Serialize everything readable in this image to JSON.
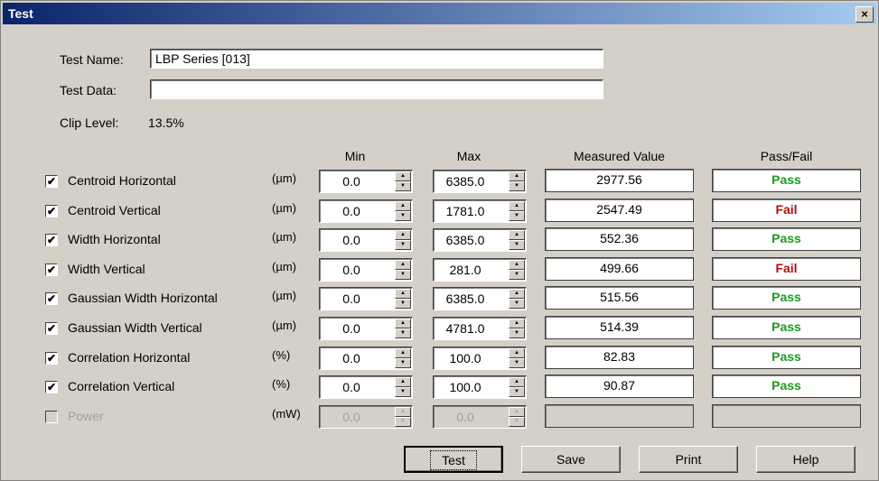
{
  "window": {
    "title": "Test",
    "close_label": "×"
  },
  "form": {
    "test_name_label": "Test Name:",
    "test_name_value": "LBP Series [013]",
    "test_data_label": "Test Data:",
    "test_data_value": "",
    "clip_level_label": "Clip Level:",
    "clip_level_value": "13.5%"
  },
  "columns": {
    "min": "Min",
    "max": "Max",
    "measured": "Measured Value",
    "passfail": "Pass/Fail"
  },
  "rows": [
    {
      "label": "Centroid Horizontal",
      "unit": "(µm)",
      "min": "0.0",
      "max": "6385.0",
      "measured": "2977.56",
      "result": "Pass",
      "checked": "✔"
    },
    {
      "label": "Centroid Vertical",
      "unit": "(µm)",
      "min": "0.0",
      "max": "1781.0",
      "measured": "2547.49",
      "result": "Fail",
      "checked": "✔"
    },
    {
      "label": "Width Horizontal",
      "unit": "(µm)",
      "min": "0.0",
      "max": "6385.0",
      "measured": "552.36",
      "result": "Pass",
      "checked": "✔"
    },
    {
      "label": "Width Vertical",
      "unit": "(µm)",
      "min": "0.0",
      "max": "281.0",
      "measured": "499.66",
      "result": "Fail",
      "checked": "✔"
    },
    {
      "label": "Gaussian Width Horizontal",
      "unit": "(µm)",
      "min": "0.0",
      "max": "6385.0",
      "measured": "515.56",
      "result": "Pass",
      "checked": "✔"
    },
    {
      "label": "Gaussian Width Vertical",
      "unit": "(µm)",
      "min": "0.0",
      "max": "4781.0",
      "measured": "514.39",
      "result": "Pass",
      "checked": "✔"
    },
    {
      "label": "Correlation Horizontal",
      "unit": "(%)",
      "min": "0.0",
      "max": "100.0",
      "measured": "82.83",
      "result": "Pass",
      "checked": "✔"
    },
    {
      "label": "Correlation Vertical",
      "unit": "(%)",
      "min": "0.0",
      "max": "100.0",
      "measured": "90.87",
      "result": "Pass",
      "checked": "✔"
    },
    {
      "label": "Power",
      "unit": "(mW)",
      "min": "0.0",
      "max": "0.0",
      "measured": "",
      "result": "",
      "checked": ""
    }
  ],
  "buttons": {
    "test": "Test",
    "save": "Save",
    "print": "Print",
    "help": "Help"
  },
  "colors": {
    "pass": "#1d9c1d",
    "fail": "#b01010",
    "title_bar": "#0a246a",
    "disabled_text": "#a0a0a0"
  }
}
